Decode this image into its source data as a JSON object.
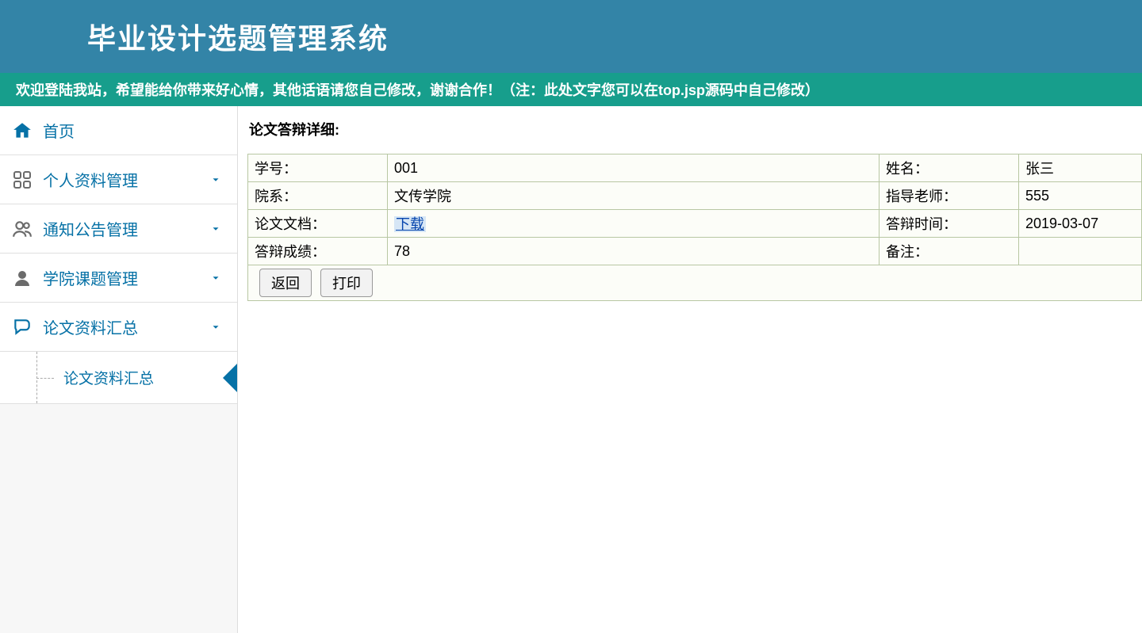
{
  "header": {
    "title": "毕业设计选题管理系统"
  },
  "banner": {
    "text": "欢迎登陆我站，希望能给你带来好心情，其他话语请您自己修改，谢谢合作！（注：此处文字您可以在top.jsp源码中自己修改）"
  },
  "sidebar": {
    "items": [
      {
        "label": "首页",
        "expandable": false
      },
      {
        "label": "个人资料管理",
        "expandable": true
      },
      {
        "label": "通知公告管理",
        "expandable": true
      },
      {
        "label": "学院课题管理",
        "expandable": true
      },
      {
        "label": "论文资料汇总",
        "expandable": true
      }
    ],
    "sub": {
      "label": "论文资料汇总"
    }
  },
  "detail": {
    "title": "论文答辩详细:",
    "rows": [
      {
        "l1": "学号：",
        "v1": "001",
        "l2": "姓名：",
        "v2": "张三"
      },
      {
        "l1": "院系：",
        "v1": "文传学院",
        "l2": "指导老师：",
        "v2": "555"
      },
      {
        "l1": "论文文档：",
        "v1_link": "下载",
        "l2": "答辩时间：",
        "v2": "2019-03-07"
      },
      {
        "l1": "答辩成绩：",
        "v1": "78",
        "l2": "备注：",
        "v2": ""
      }
    ],
    "buttons": {
      "back": "返回",
      "print": "打印"
    }
  }
}
